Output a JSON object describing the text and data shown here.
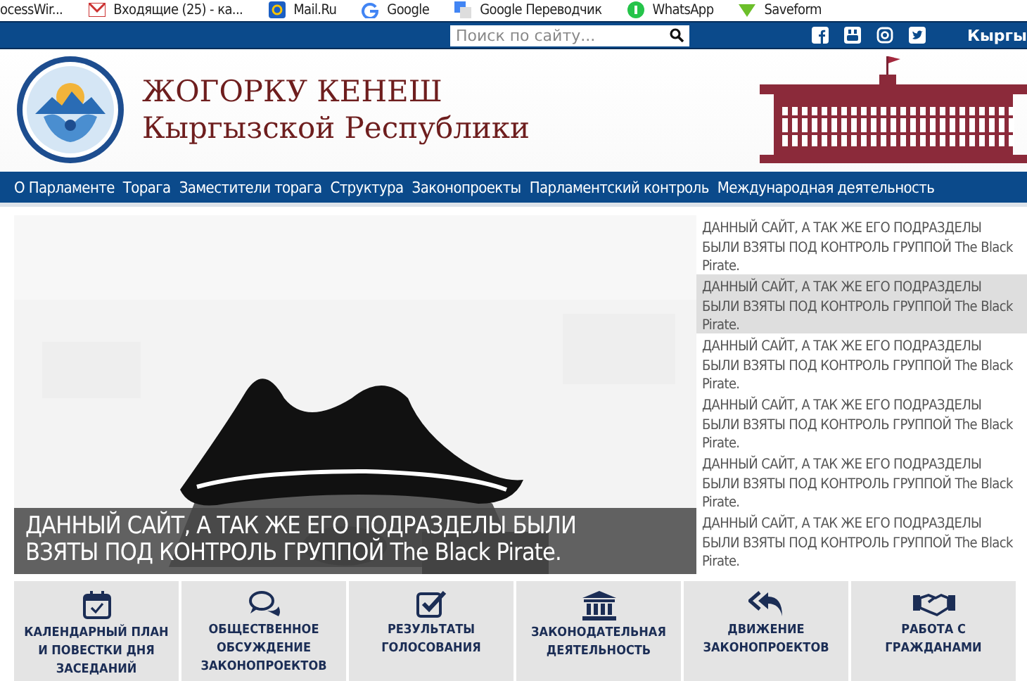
{
  "bookmarks": [
    {
      "label": "ocessWir..."
    },
    {
      "label": "Входящие (25) - ка..."
    },
    {
      "label": "Mail.Ru"
    },
    {
      "label": "Google"
    },
    {
      "label": "Google Переводчик"
    },
    {
      "label": "WhatsApp"
    },
    {
      "label": "Saveform"
    }
  ],
  "top_bar": {
    "search": {
      "placeholder": "Поиск по сайту..."
    },
    "language": "Кыргы"
  },
  "header": {
    "title": "ЖОГОРКУ КЕНЕШ",
    "subtitle": "Кыргызской Республики"
  },
  "nav": {
    "items": [
      "О Парламенте",
      "Торага",
      "Заместители торага",
      "Структура",
      "Законопроекты",
      "Парламентский контроль",
      "Международная деятельность"
    ]
  },
  "slider": {
    "caption": "ДАННЫЙ САЙТ, А ТАК ЖЕ ЕГО ПОДРАЗДЕЛЫ БЫЛИ ВЗЯТЫ ПОД КОНТРОЛЬ ГРУППОЙ The Black Pirate."
  },
  "news": [
    {
      "text": "ДАННЫЙ САЙТ, А ТАК ЖЕ ЕГО ПОДРАЗДЕЛЫ БЫЛИ ВЗЯТЫ ПОД КОНТРОЛЬ ГРУППОЙ The Black Pirate.",
      "selected": false
    },
    {
      "text": "ДАННЫЙ САЙТ, А ТАК ЖЕ ЕГО ПОДРАЗДЕЛЫ БЫЛИ ВЗЯТЫ ПОД КОНТРОЛЬ ГРУППОЙ The Black Pirate.",
      "selected": true
    },
    {
      "text": "ДАННЫЙ САЙТ, А ТАК ЖЕ ЕГО ПОДРАЗДЕЛЫ БЫЛИ ВЗЯТЫ ПОД КОНТРОЛЬ ГРУППОЙ The Black Pirate.",
      "selected": false
    },
    {
      "text": "ДАННЫЙ САЙТ, А ТАК ЖЕ ЕГО ПОДРАЗДЕЛЫ БЫЛИ ВЗЯТЫ ПОД КОНТРОЛЬ ГРУППОЙ The Black Pirate.",
      "selected": false
    },
    {
      "text": "ДАННЫЙ САЙТ, А ТАК ЖЕ ЕГО ПОДРАЗДЕЛЫ БЫЛИ ВЗЯТЫ ПОД КОНТРОЛЬ ГРУППОЙ The Black Pirate.",
      "selected": false
    },
    {
      "text": "ДАННЫЙ САЙТ, А ТАК ЖЕ ЕГО ПОДРАЗДЕЛЫ БЫЛИ ВЗЯТЫ ПОД КОНТРОЛЬ ГРУППОЙ The Black Pirate.",
      "selected": false
    }
  ],
  "tiles": [
    {
      "label": "КАЛЕНДАРНЫЙ ПЛАН И ПОВЕСТКИ ДНЯ ЗАСЕДАНИЙ"
    },
    {
      "label": "ОБЩЕСТВЕННОЕ ОБСУЖДЕНИЕ ЗАКОНОПРОЕКТОВ"
    },
    {
      "label": "РЕЗУЛЬТАТЫ ГОЛОСОВАНИЯ"
    },
    {
      "label": "ЗАКОНОДАТЕЛЬНАЯ ДЕЯТЕЛЬНОСТЬ"
    },
    {
      "label": "ДВИЖЕНИЕ ЗАКОНОПРОЕКТОВ"
    },
    {
      "label": "РАБОТА С ГРАЖДАНАМИ"
    }
  ]
}
